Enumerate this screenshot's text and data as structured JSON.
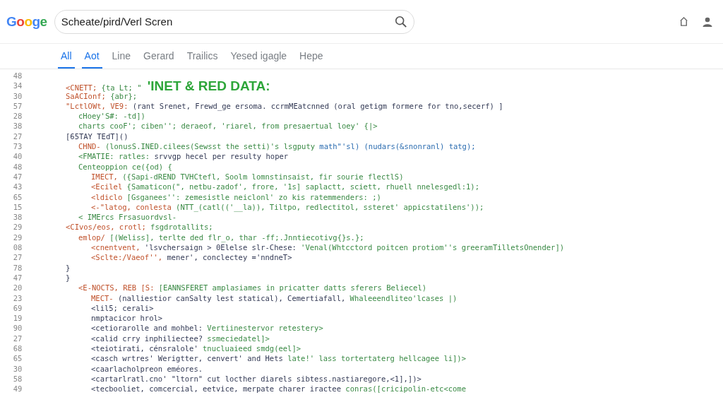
{
  "header": {
    "logo": "Googe",
    "search": {
      "value": "Scheate/pird/Verl Scren"
    }
  },
  "tabs": [
    {
      "label": "All",
      "selected": true
    },
    {
      "label": "Aot",
      "selected": true
    },
    {
      "label": "Line",
      "selected": false
    },
    {
      "label": "Gerard",
      "selected": false
    },
    {
      "label": "Trailics",
      "selected": false
    },
    {
      "label": "Yesed igagle",
      "selected": false
    },
    {
      "label": "Hepe",
      "selected": false
    }
  ],
  "code": {
    "lines": [
      {
        "number": "48"
      },
      {
        "number": "34",
        "segments": [
          {
            "kind": "keyword",
            "text": "<CNETT;"
          },
          {
            "kind": "string",
            "text": "{ta Lt; \""
          }
        ],
        "heading": "'INET & RED DATA:"
      },
      {
        "number": "30",
        "segments": [
          {
            "kind": "keyword",
            "text": "SaACIonf;"
          },
          {
            "kind": "string",
            "text": "{abr};"
          }
        ]
      },
      {
        "number": "57",
        "segments": [
          {
            "kind": "keyword",
            "text": "\"LctlOWt, VE9:"
          },
          {
            "kind": "plain",
            "text": "(rant Srenet, Frewd_ge ersoma. ccrmMEatcnned (oral getigm formere for tno,secerf) ]"
          }
        ],
        "children": [
          {
            "number": "28",
            "segments": [
              {
                "kind": "string",
                "text": "cHoey'S#: -td])"
              }
            ]
          },
          {
            "number": "38",
            "segments": [
              {
                "kind": "string",
                "text": "charts cooF'; ciben''; deraeof, 'riarel, from presaertual loey' {|>"
              }
            ]
          }
        ]
      },
      {
        "number": "27",
        "segments": [
          {
            "kind": "plain",
            "text": "[65TAY TEdT]()"
          }
        ],
        "children": [
          {
            "number": "73",
            "segments": [
              {
                "kind": "keyword",
                "text": "CHND-"
              },
              {
                "kind": "string",
                "text": "(lonusS.INED.cilees(Sewsst the setti)'s lsgputy"
              },
              {
                "kind": "link",
                "text": "math\"'sl) (nudars(&snonranl) tatg);"
              }
            ]
          },
          {
            "number": "40",
            "segments": [
              {
                "kind": "string",
                "text": "<FMATIE: ratles:"
              },
              {
                "kind": "plain",
                "text": "srvvgp hecel per resulty hoper"
              }
            ]
          },
          {
            "number": "48",
            "segments": [
              {
                "kind": "string",
                "text": "Centeoppion ce({od) {"
              }
            ],
            "children": [
              {
                "number": "47",
                "segments": [
                  {
                    "kind": "keyword",
                    "text": "IMECT,"
                  },
                  {
                    "kind": "string",
                    "text": "({Sapi-dREND TVHCtefl, Soolm lomnstinsaist, fir sourie flectlS)"
                  }
                ]
              },
              {
                "number": "43",
                "segments": [
                  {
                    "kind": "keyword",
                    "text": "<Ecilel"
                  },
                  {
                    "kind": "string",
                    "text": "{Samaticon(\", netbu-zadof', frore, '1s] saplactt, sciett, rhuell nnelesgedl:1);"
                  }
                ]
              },
              {
                "number": "65",
                "segments": [
                  {
                    "kind": "keyword",
                    "text": "<ldiclo"
                  },
                  {
                    "kind": "string",
                    "text": "[Gsganees'': zemesistle neiclonl' zo kis ratemmenders: ;)"
                  }
                ]
              },
              {
                "number": "15",
                "segments": [
                  {
                    "kind": "keyword",
                    "text": "<-\"latog, conlesta"
                  },
                  {
                    "kind": "string",
                    "text": "(NTT_(catl(('__la)), Tiltpo, redlectitol, ssteret' appicstatilens'));"
                  }
                ]
              }
            ]
          },
          {
            "number": "38",
            "segments": [
              {
                "kind": "string",
                "text": "< IMErcs Frsasuordvsl-"
              }
            ]
          }
        ]
      },
      {
        "number": "29",
        "segments": [
          {
            "kind": "keyword",
            "text": "<CIvos/eos, crotl;"
          },
          {
            "kind": "string",
            "text": "fsgdrotallits;"
          }
        ],
        "children": [
          {
            "number": "29",
            "segments": [
              {
                "kind": "keyword",
                "text": "emlop/"
              },
              {
                "kind": "string",
                "text": "[(Weliss], terlte ded flr_o, thar -ff;.Jnntiecotivg{}s.};"
              }
            ],
            "children": [
              {
                "number": "08",
                "segments": [
                  {
                    "kind": "keyword",
                    "text": "<cnentvent,"
                  },
                  {
                    "kind": "plain",
                    "text": "'lsvchersaign > 0Elelse slr-Chese:"
                  },
                  {
                    "kind": "string",
                    "text": "'Venal(Whtcctord poitcen protiom''s greeramTilletsOnender])"
                  }
                ]
              },
              {
                "number": "27",
                "segments": [
                  {
                    "kind": "keyword",
                    "text": "<Sclte:/Vaeof'',"
                  },
                  {
                    "kind": "plain",
                    "text": "mener', conclectey ='nndneT>"
                  }
                ]
              }
            ]
          }
        ]
      },
      {
        "number": "78",
        "segments": [
          {
            "kind": "plain",
            "text": "}"
          }
        ]
      },
      {
        "number": "47",
        "segments": [
          {
            "kind": "plain",
            "text": "}"
          }
        ],
        "children": [
          {
            "number": "20",
            "segments": [
              {
                "kind": "keyword",
                "text": "<E-NOCTS, REB [S:"
              },
              {
                "kind": "string",
                "text": "[EANNSFERET amplasiames in pricatter datts sferers Beliecel)"
              }
            ],
            "children": [
              {
                "number": "23",
                "segments": [
                  {
                    "kind": "keyword",
                    "text": "MECT-"
                  },
                  {
                    "kind": "plain",
                    "text": "(nalliestior canSalty lest statical), Cemertiafall,"
                  },
                  {
                    "kind": "string",
                    "text": "Whaleeendliteo'lcases |)"
                  }
                ]
              },
              {
                "number": "69",
                "segments": [
                  {
                    "kind": "plain",
                    "text": "<lil5; cerali>"
                  }
                ]
              },
              {
                "number": "19",
                "segments": [
                  {
                    "kind": "plain",
                    "text": "nmptacicor hrol>"
                  }
                ]
              },
              {
                "number": "90",
                "segments": [
                  {
                    "kind": "plain",
                    "text": "<cetiorarolle and mohbel:"
                  },
                  {
                    "kind": "string",
                    "text": "Vertiinestervor retestery>"
                  }
                ]
              },
              {
                "number": "27",
                "segments": [
                  {
                    "kind": "plain",
                    "text": "<calid crry inphiliectee?"
                  },
                  {
                    "kind": "string",
                    "text": "ssmeciedatel]>"
                  }
                ]
              },
              {
                "number": "68",
                "segments": [
                  {
                    "kind": "plain",
                    "text": "<teiotirati, cénsralole'"
                  },
                  {
                    "kind": "string",
                    "text": "tnucluaieed smdg(eel]>"
                  }
                ]
              },
              {
                "number": "65",
                "segments": [
                  {
                    "kind": "plain",
                    "text": "<casch wrtres' Werigtter, cenvert' and Hets"
                  },
                  {
                    "kind": "string",
                    "text": "late!' lass tortertaterg hellcagee li])>"
                  }
                ]
              },
              {
                "number": "30",
                "segments": [
                  {
                    "kind": "plain",
                    "text": "<caarlacholpreon eméores."
                  }
                ]
              },
              {
                "number": "58",
                "segments": [
                  {
                    "kind": "plain",
                    "text": "<cartarlratl.cno' \"ltorn\" cut locther diarels sibtess.nastiaregore,<1],])>"
                  }
                ]
              },
              {
                "number": "49",
                "segments": [
                  {
                    "kind": "plain",
                    "text": "<tecbooliet, comcercial, eetvice, merpate charer iractee"
                  },
                  {
                    "kind": "string",
                    "text": "conras([cricipolin-etc<come"
                  }
                ]
              }
            ]
          }
        ]
      }
    ]
  }
}
